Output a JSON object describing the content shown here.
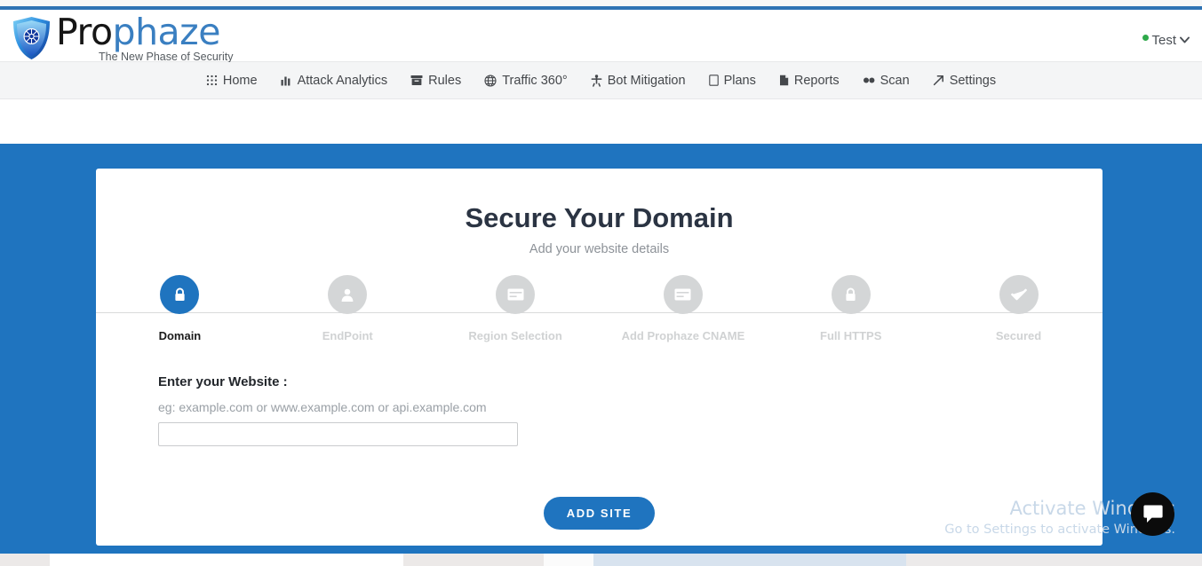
{
  "browser": {
    "accent_color": "#2f73b4"
  },
  "header": {
    "logo": {
      "word_dark": "Pro",
      "word_light": "phaze",
      "tagline": "The New Phase of Security",
      "icon": "shield-icon"
    },
    "user": {
      "name": "Test",
      "status_dot_color": "#2ea94a",
      "caret": "⌄"
    }
  },
  "nav": {
    "items": [
      {
        "label": "Home",
        "icon": "grid-icon"
      },
      {
        "label": "Attack Analytics",
        "icon": "bar-chart-icon"
      },
      {
        "label": "Rules",
        "icon": "archive-icon"
      },
      {
        "label": "Traffic 360°",
        "icon": "globe-icon"
      },
      {
        "label": "Bot Mitigation",
        "icon": "robot-icon"
      },
      {
        "label": "Plans",
        "icon": "document-icon"
      },
      {
        "label": "Reports",
        "icon": "report-icon"
      },
      {
        "label": "Scan",
        "icon": "binoculars-icon"
      },
      {
        "label": "Settings",
        "icon": "arrow-up-right-icon"
      }
    ]
  },
  "page": {
    "background_color": "#1f74bf",
    "card": {
      "title": "Secure Your Domain",
      "subtitle": "Add your website details",
      "steps": [
        {
          "label": "Domain",
          "icon": "lock-icon",
          "state": "active"
        },
        {
          "label": "EndPoint",
          "icon": "user-icon",
          "state": "inactive"
        },
        {
          "label": "Region Selection",
          "icon": "card-icon",
          "state": "inactive"
        },
        {
          "label": "Add Prophaze CNAME",
          "icon": "card-icon",
          "state": "inactive"
        },
        {
          "label": "Full HTTPS",
          "icon": "lock-icon",
          "state": "inactive"
        },
        {
          "label": "Secured",
          "icon": "check-icon",
          "state": "inactive"
        }
      ],
      "form": {
        "label": "Enter your Website :",
        "hint": "eg: example.com or www.example.com or api.example.com",
        "input_value": "",
        "input_placeholder": ""
      },
      "submit_label": "ADD SITE",
      "accent_color": "#1f74bf"
    }
  },
  "watermark": {
    "title": "Activate Windows",
    "subtitle": "Go to Settings to activate Windows."
  },
  "chat": {
    "icon": "chat-bubble-icon"
  }
}
